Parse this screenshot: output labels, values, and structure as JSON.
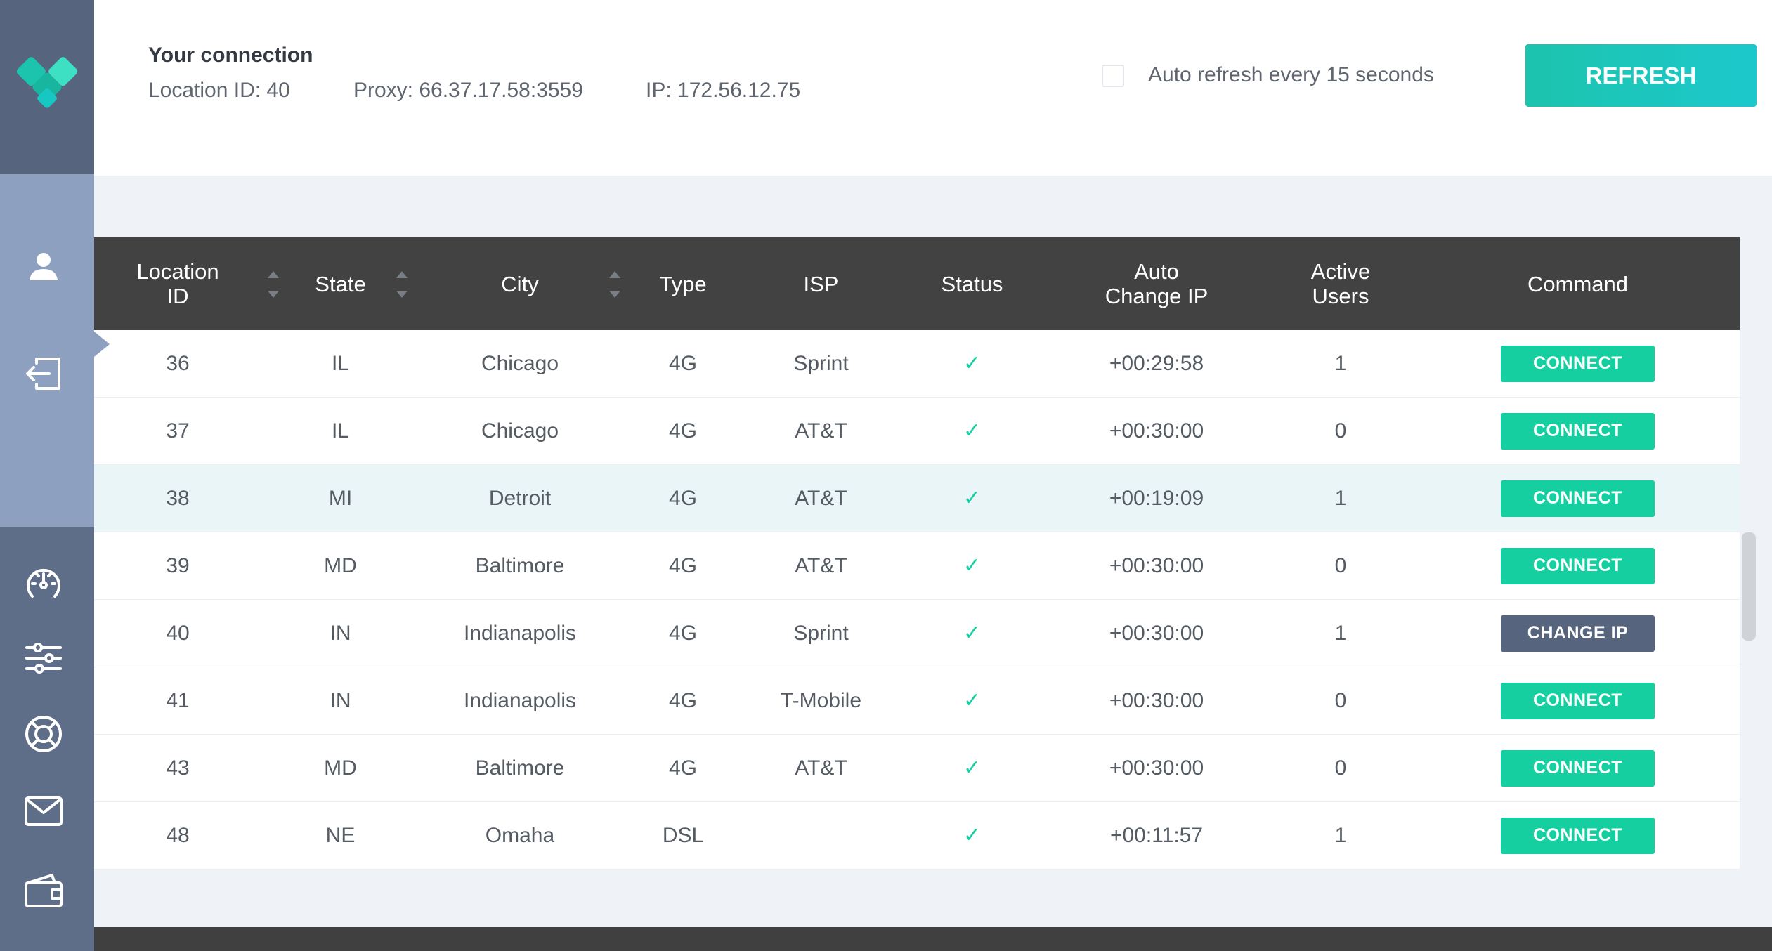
{
  "header": {
    "title": "Your connection",
    "location": "Location ID: 40",
    "proxy": "Proxy: 66.37.17.58:3559",
    "ip": "IP: 172.56.12.75",
    "auto_refresh_label": "Auto refresh every 15 seconds",
    "auto_refresh_checked": false,
    "refresh_label": "REFRESH"
  },
  "sidebar": {
    "icons": [
      "logo-icon",
      "user-icon",
      "logout-icon",
      "speedometer-icon",
      "settings-sliders-icon",
      "support-lifebuoy-icon",
      "mail-icon",
      "wallet-icon"
    ]
  },
  "table": {
    "columns": {
      "location_id_1": "Location",
      "location_id_2": "ID",
      "state": "State",
      "city": "City",
      "type": "Type",
      "isp": "ISP",
      "status": "Status",
      "auto_change_1": "Auto",
      "auto_change_2": "Change IP",
      "active_1": "Active",
      "active_2": "Users",
      "command": "Command"
    },
    "rows": [
      {
        "id": "36",
        "state": "IL",
        "city": "Chicago",
        "type": "4G",
        "isp": "Sprint",
        "status": "✓",
        "change": "+00:29:58",
        "users": "1",
        "command": "CONNECT"
      },
      {
        "id": "37",
        "state": "IL",
        "city": "Chicago",
        "type": "4G",
        "isp": "AT&T",
        "status": "✓",
        "change": "+00:30:00",
        "users": "0",
        "command": "CONNECT"
      },
      {
        "id": "38",
        "state": "MI",
        "city": "Detroit",
        "type": "4G",
        "isp": "AT&T",
        "status": "✓",
        "change": "+00:19:09",
        "users": "1",
        "command": "CONNECT"
      },
      {
        "id": "39",
        "state": "MD",
        "city": "Baltimore",
        "type": "4G",
        "isp": "AT&T",
        "status": "✓",
        "change": "+00:30:00",
        "users": "0",
        "command": "CONNECT"
      },
      {
        "id": "40",
        "state": "IN",
        "city": "Indianapolis",
        "type": "4G",
        "isp": "Sprint",
        "status": "✓",
        "change": "+00:30:00",
        "users": "1",
        "command": "CHANGE IP"
      },
      {
        "id": "41",
        "state": "IN",
        "city": "Indianapolis",
        "type": "4G",
        "isp": "T-Mobile",
        "status": "✓",
        "change": "+00:30:00",
        "users": "0",
        "command": "CONNECT"
      },
      {
        "id": "43",
        "state": "MD",
        "city": "Baltimore",
        "type": "4G",
        "isp": "AT&T",
        "status": "✓",
        "change": "+00:30:00",
        "users": "0",
        "command": "CONNECT"
      },
      {
        "id": "48",
        "state": "NE",
        "city": "Omaha",
        "type": "DSL",
        "isp": "",
        "status": "✓",
        "change": "+00:11:57",
        "users": "1",
        "command": "CONNECT"
      }
    ]
  },
  "colors": {
    "accent": "#16cfa0",
    "sidebar_dark": "#56647e",
    "sidebar_light": "#8ea0bf",
    "table_header": "#424242",
    "highlight_row": "#e9f5f6"
  }
}
